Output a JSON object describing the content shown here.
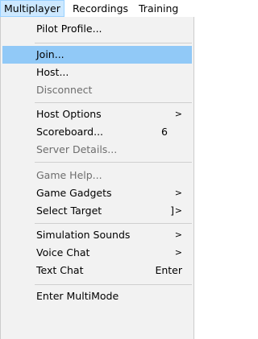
{
  "menubar": {
    "items": [
      {
        "label": "Multiplayer"
      },
      {
        "label": "Recordings"
      },
      {
        "label": "Training"
      }
    ]
  },
  "menu": {
    "items": [
      {
        "label": "Pilot Profile...",
        "shortcut": "",
        "arrow": ""
      },
      {
        "label": "Join...",
        "shortcut": "",
        "arrow": ""
      },
      {
        "label": "Host...",
        "shortcut": "",
        "arrow": ""
      },
      {
        "label": "Disconnect",
        "shortcut": "",
        "arrow": ""
      },
      {
        "label": "Host Options",
        "shortcut": "",
        "arrow": ">"
      },
      {
        "label": "Scoreboard...",
        "shortcut": "6",
        "arrow": ""
      },
      {
        "label": "Server Details...",
        "shortcut": "",
        "arrow": ""
      },
      {
        "label": "Game Help...",
        "shortcut": "",
        "arrow": ""
      },
      {
        "label": "Game Gadgets",
        "shortcut": "",
        "arrow": ">"
      },
      {
        "label": "Select Target",
        "shortcut": "]",
        "arrow": ">"
      },
      {
        "label": "Simulation Sounds",
        "shortcut": "",
        "arrow": ">"
      },
      {
        "label": "Voice Chat",
        "shortcut": "",
        "arrow": ">"
      },
      {
        "label": "Text Chat",
        "shortcut": "Enter",
        "arrow": ""
      },
      {
        "label": "Enter MultiMode",
        "shortcut": "",
        "arrow": ""
      }
    ]
  },
  "colors": {
    "menubar_active_bg": "#cce8ff",
    "highlight_bg": "#91c9f7",
    "disabled_text": "#6d6d6d",
    "menu_bg": "#f2f2f2"
  }
}
